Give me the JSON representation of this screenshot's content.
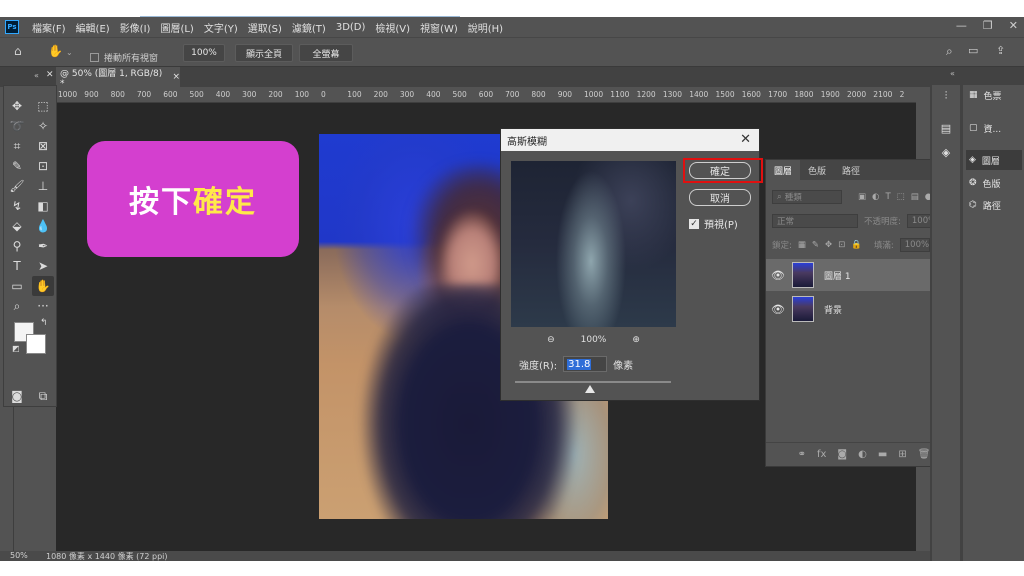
{
  "app": {
    "logo": "Ps",
    "menus": [
      "檔案(F)",
      "編輯(E)",
      "影像(I)",
      "圖層(L)",
      "文字(Y)",
      "選取(S)",
      "濾鏡(T)",
      "3D(D)",
      "檢視(V)",
      "視窗(W)",
      "說明(H)"
    ]
  },
  "options": {
    "scroll_all_label": "捲動所有視窗",
    "zoom_value": "100%",
    "fit_screen_label": "顯示全頁",
    "fill_screen_label": "全螢幕"
  },
  "document": {
    "tab_title": "@ 50% (圖層 1, RGB/8) *",
    "status": "50%",
    "status_info": "1080 像素 x 1440 像素 (72 ppi)"
  },
  "ruler_ticks": [
    "1000",
    "900",
    "800",
    "700",
    "600",
    "500",
    "400",
    "300",
    "200",
    "100",
    "0",
    "100",
    "200",
    "300",
    "400",
    "500",
    "600",
    "700",
    "800",
    "900",
    "1000",
    "1100",
    "1200",
    "1300",
    "1400",
    "1500",
    "1600",
    "1700",
    "1800",
    "1900",
    "2000",
    "2100",
    "2"
  ],
  "callout": {
    "text_white": "按下",
    "text_yellow": "確定",
    "bg_color": "#d43fcf"
  },
  "dialog": {
    "title": "高斯模糊",
    "ok_label": "確定",
    "cancel_label": "取消",
    "preview_label": "預視(P)",
    "preview_checked": true,
    "zoom": "100%",
    "radius_label": "強度(R):",
    "radius_value": "31.8",
    "radius_unit": "像素"
  },
  "layers_panel": {
    "tabs": [
      "圖層",
      "色版",
      "路徑"
    ],
    "filter_placeholder": "種類",
    "blend_mode": "正常",
    "opacity_label": "不透明度:",
    "opacity_value": "100%",
    "lock_label": "鎖定:",
    "fill_label": "填滿:",
    "fill_value": "100%",
    "layers": [
      {
        "name": "圖層 1",
        "selected": true,
        "locked": false
      },
      {
        "name": "背景",
        "selected": false,
        "locked": true
      }
    ]
  },
  "dock": {
    "items": [
      "色票",
      "資...",
      "圖層",
      "色版",
      "路徑"
    ]
  }
}
